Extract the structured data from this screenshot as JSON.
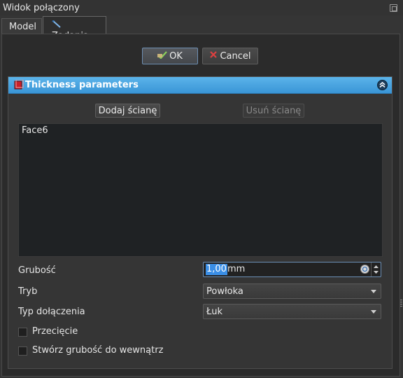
{
  "window": {
    "title": "Widok połączony"
  },
  "tabs": [
    {
      "label": "Model"
    },
    {
      "label": "Zadania"
    }
  ],
  "dialog": {
    "ok_label": "OK",
    "cancel_label": "Cancel"
  },
  "section": {
    "title": "Thickness parameters",
    "add_face_label": "Dodaj ścianę",
    "remove_face_label": "Usuń ścianę",
    "faces": [
      "Face6"
    ]
  },
  "form": {
    "thickness_label": "Grubość",
    "thickness_value": "1,00",
    "thickness_unit": "mm",
    "mode_label": "Tryb",
    "mode_value": "Powłoka",
    "join_label": "Typ dołączenia",
    "join_value": "Łuk",
    "intersection_label": "Przecięcie",
    "intersection_checked": false,
    "inward_label": "Stwórz grubość do wewnątrz",
    "inward_checked": false
  },
  "colors": {
    "accent": "#3a95d6",
    "selection": "#3a8ee6",
    "background": "#2b2b2b"
  }
}
